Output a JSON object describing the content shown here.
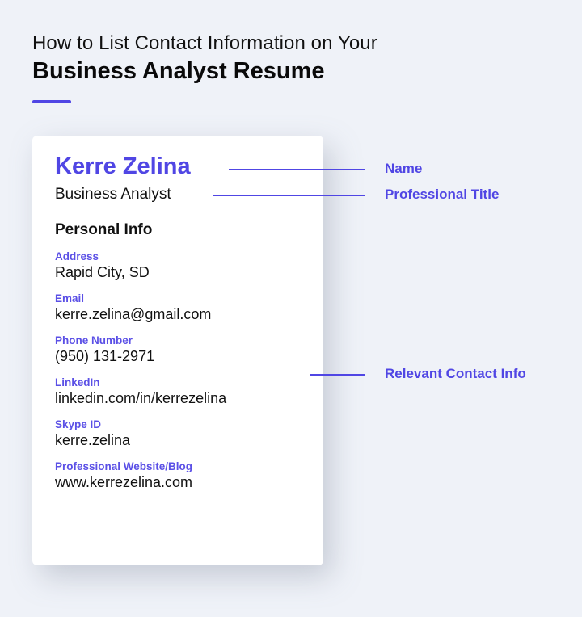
{
  "header": {
    "line1": "How to List Contact Information on Your",
    "line2": "Business Analyst Resume"
  },
  "resume": {
    "name": "Kerre Zelina",
    "title": "Business Analyst",
    "section_title": "Personal Info",
    "fields": [
      {
        "label": "Address",
        "value": "Rapid City, SD"
      },
      {
        "label": "Email",
        "value": "kerre.zelina@gmail.com"
      },
      {
        "label": "Phone Number",
        "value": "(950) 131-2971"
      },
      {
        "label": "LinkedIn",
        "value": "linkedin.com/in/kerrezelina"
      },
      {
        "label": "Skype ID",
        "value": "kerre.zelina"
      },
      {
        "label": "Professional Website/Blog",
        "value": "www.kerrezelina.com"
      }
    ]
  },
  "annotations": {
    "name": "Name",
    "title": "Professional Title",
    "contact": "Relevant Contact Info"
  },
  "colors": {
    "accent": "#5046e4",
    "background": "#eff2f8",
    "card": "#ffffff",
    "text": "#111111"
  }
}
